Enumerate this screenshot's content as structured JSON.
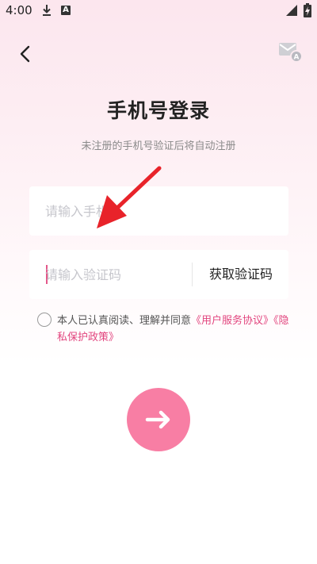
{
  "status_bar": {
    "time": "4:00",
    "icons": [
      "download-icon",
      "a-notification-icon",
      "signal-icon",
      "battery-charging-icon"
    ]
  },
  "header": {
    "back_icon": "back-chevron-icon",
    "mail_icon": "mail-account-icon"
  },
  "title": "手机号登录",
  "subtitle": "未注册的手机号验证后将自动注册",
  "phone": {
    "placeholder": "请输入手机号",
    "value": ""
  },
  "code": {
    "placeholder": "请输入验证码",
    "value": "",
    "get_code_label": "获取验证码"
  },
  "agreement": {
    "checked": false,
    "prefix": "本人已认真阅读、理解并同意",
    "user_agreement": "《用户服务协议》",
    "privacy_policy": "《隐私保护政策》"
  },
  "submit": {
    "icon": "arrow-right-icon"
  },
  "colors": {
    "accent": "#e2457e",
    "submit_bg": "#f87ea4",
    "annotation_arrow": "#e8232a"
  }
}
